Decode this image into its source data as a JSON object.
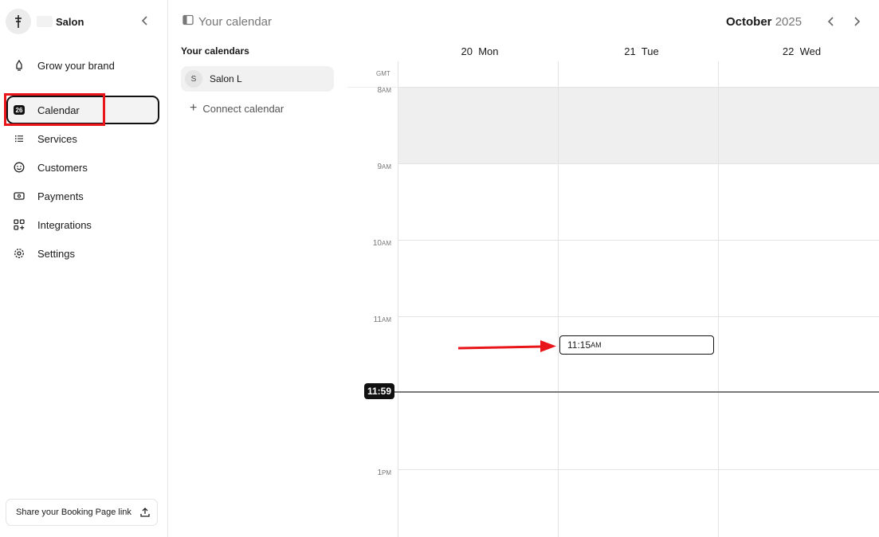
{
  "sidebar": {
    "brand_name": "Salon",
    "items": [
      {
        "label": "Grow your brand",
        "icon": "rocket-icon"
      },
      {
        "label": "Calendar",
        "icon": "calendar-icon",
        "badge": "26",
        "active": true
      },
      {
        "label": "Services",
        "icon": "list-icon"
      },
      {
        "label": "Customers",
        "icon": "smiley-icon"
      },
      {
        "label": "Payments",
        "icon": "banknote-icon"
      },
      {
        "label": "Integrations",
        "icon": "apps-icon"
      },
      {
        "label": "Settings",
        "icon": "gear-icon"
      }
    ],
    "share_label": "Share your Booking Page link"
  },
  "calendars_panel": {
    "header": "Your calendar",
    "list_title": "Your calendars",
    "entry": {
      "initial": "S",
      "name": "Salon L"
    },
    "connect_label": "Connect calendar"
  },
  "header": {
    "month": "October",
    "year": "2025"
  },
  "grid": {
    "timezone": "GMT",
    "days": [
      {
        "num": "20",
        "name": "Mon"
      },
      {
        "num": "21",
        "name": "Tue"
      },
      {
        "num": "22",
        "name": "Wed"
      }
    ],
    "hours": [
      {
        "h": "8",
        "ap": "AM"
      },
      {
        "h": "9",
        "ap": "AM"
      },
      {
        "h": "10",
        "ap": "AM"
      },
      {
        "h": "11",
        "ap": "AM"
      },
      {
        "h": "1",
        "ap": "PM"
      }
    ],
    "now": "11:59",
    "event": {
      "time": "11:15",
      "ap": "AM"
    }
  },
  "colors": {
    "annotation": "#e8161b",
    "accent": "#111111"
  }
}
